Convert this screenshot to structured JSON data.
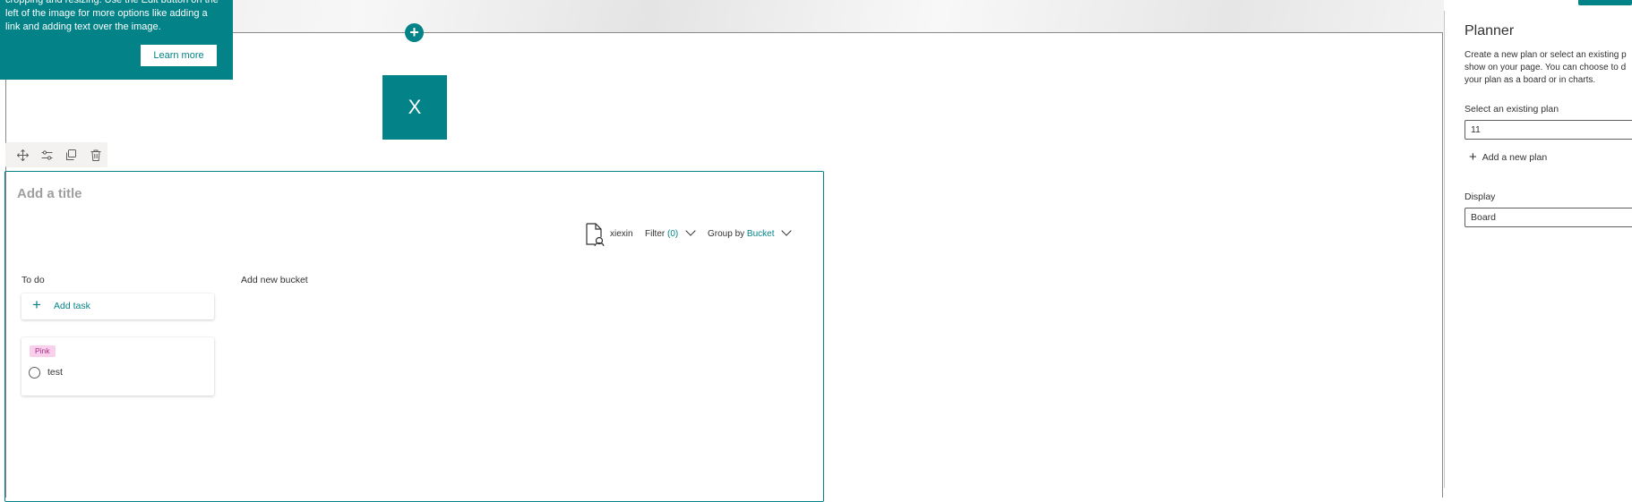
{
  "callout": {
    "text": "cropping and resizing. Use the Edit button on the left of the image for more options like adding a link and adding text over the image.",
    "learn_more": "Learn more"
  },
  "section": {
    "add_icon": "+"
  },
  "image_tile": {
    "letter": "X"
  },
  "webpart_toolbar": {
    "icons": [
      "move-icon",
      "edit-properties-icon",
      "duplicate-icon",
      "delete-icon"
    ]
  },
  "planner": {
    "title_placeholder": "Add a title",
    "member": "xiexin",
    "filter_label": "Filter",
    "filter_count": "(0)",
    "group_by_label": "Group by",
    "group_by_value": "Bucket",
    "buckets": [
      {
        "name": "To do",
        "add_task_label": "Add task",
        "tasks": [
          {
            "label": "Pink",
            "title": "test"
          }
        ]
      }
    ],
    "add_bucket": "Add new bucket"
  },
  "pane": {
    "title": "Planner",
    "description_lines": [
      "Create a new plan or select an existing p",
      "show on your page. You can choose to d",
      "your plan as a board or in charts."
    ],
    "select_label": "Select an existing plan",
    "select_value": "11",
    "add_plan_label": "Add a new plan",
    "display_label": "Display",
    "display_value": "Board"
  },
  "colors": {
    "accent": "#038387",
    "label_pink_bg": "#f9d0ec",
    "label_pink_text": "#ab2d86"
  }
}
